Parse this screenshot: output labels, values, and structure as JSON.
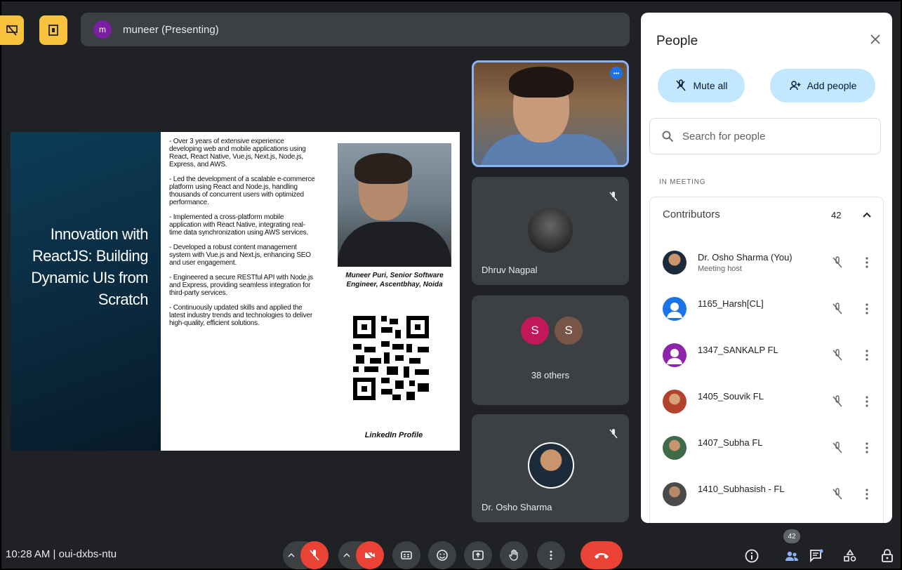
{
  "presenter": {
    "initial": "m",
    "label": "muneer (Presenting)"
  },
  "slide": {
    "title": "Innovation with ReactJS: Building Dynamic UIs from Scratch",
    "bullets": [
      "- Over 3 years of extensive experience developing web and mobile applications using React, React Native, Vue.js, Next.js, Node.js, Express, and AWS.",
      "- Led the development of a scalable e-commerce platform using React and Node.js, handling thousands of concurrent users with optimized performance.",
      "- Implemented a cross-platform mobile application with React Native, integrating real-time data synchronization using AWS services.",
      "- Developed a robust content management system with Vue.js and Next.js, enhancing SEO and user engagement.",
      "- Engineered a secure RESTful API with Node.js and Express, providing seamless integration for third-party services.",
      "- Continuously updated skills and applied the latest industry trends and technologies to deliver high-quality, efficient solutions."
    ],
    "caption": "Muneer Puri, Senior Software Engineer, Ascentbhay, Noida",
    "qr_label": "LinkedIn Profile"
  },
  "tiles": {
    "tile2_name": "Dhruv Nagpal",
    "others_initial_1": "S",
    "others_initial_2": "S",
    "others_label": "38 others",
    "tile4_name": "Dr. Osho Sharma"
  },
  "panel": {
    "title": "People",
    "mute_all": "Mute all",
    "add_people": "Add people",
    "search_placeholder": "Search for people",
    "section_label": "IN MEETING",
    "group_title": "Contributors",
    "group_count": "42",
    "participants": [
      {
        "name": "Dr. Osho Sharma (You)",
        "sub": "Meeting host"
      },
      {
        "name": "1165_Harsh[CL]",
        "sub": ""
      },
      {
        "name": "1347_SANKALP FL",
        "sub": ""
      },
      {
        "name": "1405_Souvik FL",
        "sub": ""
      },
      {
        "name": "1407_Subha FL",
        "sub": ""
      },
      {
        "name": "1410_Subhasish - FL",
        "sub": ""
      }
    ]
  },
  "bottom": {
    "time_code": "10:28 AM  |  oui-dxbs-ntu",
    "people_badge": "42"
  },
  "colors": {
    "accent": "#8ab4f8",
    "danger": "#ea4335",
    "pill": "#c2e7ff",
    "presenter_avatar": "#7b1fa2"
  }
}
